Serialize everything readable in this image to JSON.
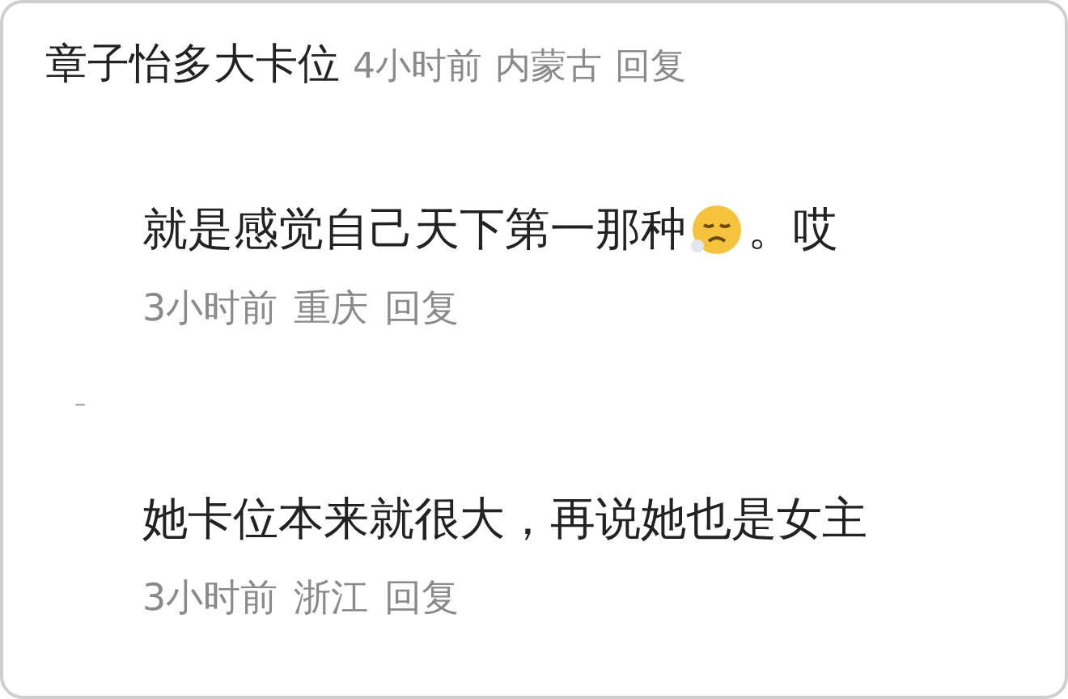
{
  "comment": {
    "author": "章子怡多大卡位",
    "time": "4小时前",
    "location": "内蒙古",
    "reply": "回复"
  },
  "replies": [
    {
      "parts": [
        {
          "kind": "text",
          "text": "就是感觉自己天下第一那种"
        },
        {
          "kind": "emoji"
        },
        {
          "kind": "text",
          "text": "。哎"
        }
      ],
      "time": "3小时前",
      "location": "重庆",
      "reply": "回复"
    },
    {
      "parts": [
        {
          "kind": "text",
          "text": "她卡位本来就很大，再说她也是女主"
        }
      ],
      "time": "3小时前",
      "location": "浙江",
      "reply": "回复"
    }
  ],
  "separator": "–"
}
